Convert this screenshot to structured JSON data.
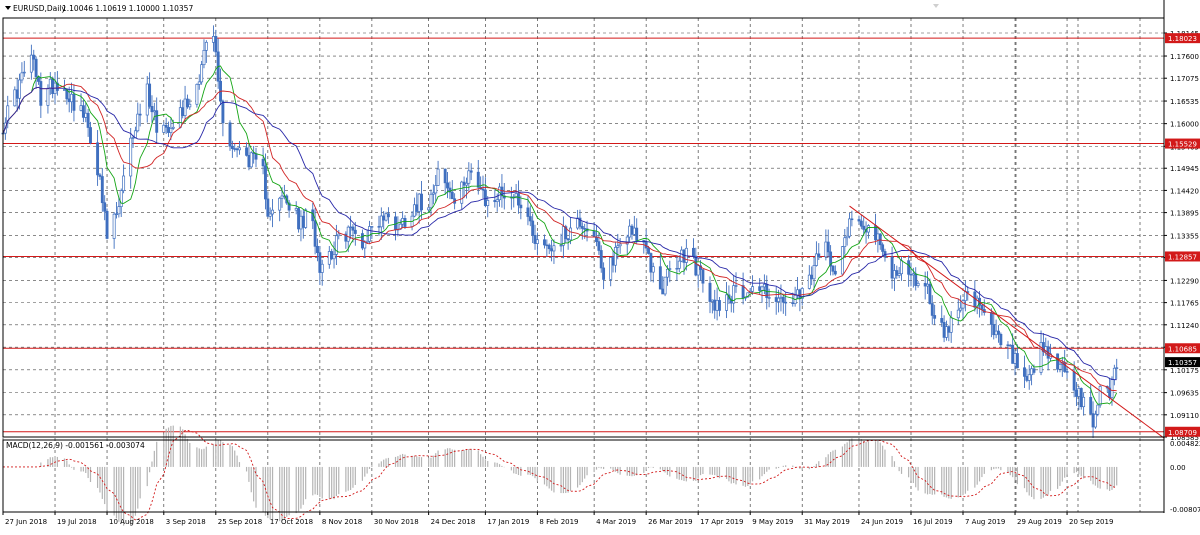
{
  "window": {
    "symbol_label": "EURUSD,Daily",
    "ohlc_label": "1.10046 1.10619 1.10000 1.10357",
    "indicator_label": "MACD(12,26,9) -0.001561 -0.003074"
  },
  "colors": {
    "background": "#ffffff",
    "candle": "#3f6fbf",
    "ma_fast": "#14a514",
    "ma_mid": "#d22626",
    "ma_slow": "#2828a8",
    "level_line": "#d21919",
    "trendline": "#d21919",
    "price_marker_bg": "#d21919",
    "current_marker_bg": "#000000",
    "grid": "#444444",
    "macd_hist": "#b4b4b4",
    "macd_signal": "#d21919"
  },
  "chart_data": [
    {
      "type": "candlestick",
      "title": "EURUSD,Daily",
      "ylim": [
        1.08585,
        1.185
      ],
      "xlim": [
        "2018-06-27",
        "2019-10-31"
      ],
      "x_tick_labels": [
        "27 Jun 2018",
        "19 Jul 2018",
        "10 Aug 2018",
        "3 Sep 2018",
        "25 Sep 2018",
        "17 Oct 2018",
        "8 Nov 2018",
        "30 Nov 2018",
        "24 Dec 2018",
        "17 Jan 2019",
        "8 Feb 2019",
        "4 Mar 2019",
        "26 Mar 2019",
        "17 Apr 2019",
        "9 May 2019",
        "31 May 2019",
        "24 Jun 2019",
        "16 Jul 2019",
        "7 Aug 2019",
        "29 Aug 2019",
        "20 Sep 2019"
      ],
      "x_tick_dates": [
        "2018-06-27",
        "2018-07-19",
        "2018-08-10",
        "2018-09-03",
        "2018-09-25",
        "2018-10-17",
        "2018-11-08",
        "2018-11-30",
        "2018-12-24",
        "2019-01-17",
        "2019-02-08",
        "2019-03-04",
        "2019-03-26",
        "2019-04-17",
        "2019-05-09",
        "2019-05-31",
        "2019-06-24",
        "2019-07-16",
        "2019-08-07",
        "2019-08-29",
        "2019-09-20"
      ],
      "y_tick_labels": [
        "1.18145",
        "1.17600",
        "1.17075",
        "1.16535",
        "1.16000",
        "1.15465",
        "1.14945",
        "1.14420",
        "1.13895",
        "1.13355",
        "1.12830",
        "1.12290",
        "1.11765",
        "1.11240",
        "1.10710",
        "1.10175",
        "1.09635",
        "1.09110",
        "1.08585"
      ],
      "grid": true,
      "price_levels": [
        1.18023,
        1.15529,
        1.12857,
        1.10685,
        1.08709
      ],
      "price_level_labels": [
        "1.18023",
        "1.15529",
        "1.12857",
        "1.10685",
        "1.08709"
      ],
      "current_price": 1.10357,
      "current_price_label": "1.10357",
      "trendline": {
        "start": [
          "2019-06-20",
          1.1405
        ],
        "end": [
          "2019-10-31",
          1.0856
        ]
      },
      "price_path": [
        [
          "2018-06-27",
          1.16
        ],
        [
          "2018-07-03",
          1.168
        ],
        [
          "2018-07-09",
          1.176
        ],
        [
          "2018-07-13",
          1.166
        ],
        [
          "2018-07-19",
          1.17
        ],
        [
          "2018-07-25",
          1.167
        ],
        [
          "2018-07-31",
          1.162
        ],
        [
          "2018-08-05",
          1.154
        ],
        [
          "2018-08-10",
          1.133
        ],
        [
          "2018-08-15",
          1.14
        ],
        [
          "2018-08-21",
          1.158
        ],
        [
          "2018-08-27",
          1.168
        ],
        [
          "2018-09-01",
          1.158
        ],
        [
          "2018-09-05",
          1.16
        ],
        [
          "2018-09-10",
          1.163
        ],
        [
          "2018-09-16",
          1.167
        ],
        [
          "2018-09-20",
          1.177
        ],
        [
          "2018-09-24",
          1.181
        ],
        [
          "2018-09-28",
          1.16
        ],
        [
          "2018-10-03",
          1.154
        ],
        [
          "2018-10-09",
          1.152
        ],
        [
          "2018-10-15",
          1.148
        ],
        [
          "2018-10-17",
          1.14
        ],
        [
          "2018-10-24",
          1.142
        ],
        [
          "2018-10-31",
          1.136
        ],
        [
          "2018-11-04",
          1.139
        ],
        [
          "2018-11-08",
          1.127
        ],
        [
          "2018-11-13",
          1.13
        ],
        [
          "2018-11-20",
          1.135
        ],
        [
          "2018-11-27",
          1.132
        ],
        [
          "2018-11-30",
          1.136
        ],
        [
          "2018-12-05",
          1.138
        ],
        [
          "2018-12-12",
          1.136
        ],
        [
          "2018-12-18",
          1.141
        ],
        [
          "2018-12-24",
          1.142
        ],
        [
          "2018-12-28",
          1.149
        ],
        [
          "2019-01-05",
          1.14
        ],
        [
          "2019-01-10",
          1.15
        ],
        [
          "2019-01-17",
          1.141
        ],
        [
          "2019-01-25",
          1.144
        ],
        [
          "2019-02-01",
          1.142
        ],
        [
          "2019-02-08",
          1.132
        ],
        [
          "2019-02-14",
          1.131
        ],
        [
          "2019-02-20",
          1.134
        ],
        [
          "2019-02-26",
          1.137
        ],
        [
          "2019-03-04",
          1.134
        ],
        [
          "2019-03-08",
          1.122
        ],
        [
          "2019-03-13",
          1.13
        ],
        [
          "2019-03-20",
          1.136
        ],
        [
          "2019-03-26",
          1.129
        ],
        [
          "2019-04-01",
          1.121
        ],
        [
          "2019-04-08",
          1.127
        ],
        [
          "2019-04-13",
          1.13
        ],
        [
          "2019-04-17",
          1.125
        ],
        [
          "2019-04-23",
          1.117
        ],
        [
          "2019-04-29",
          1.119
        ],
        [
          "2019-05-03",
          1.12
        ],
        [
          "2019-05-09",
          1.121
        ],
        [
          "2019-05-15",
          1.121
        ],
        [
          "2019-05-23",
          1.117
        ],
        [
          "2019-05-31",
          1.119
        ],
        [
          "2019-06-05",
          1.126
        ],
        [
          "2019-06-10",
          1.131
        ],
        [
          "2019-06-14",
          1.126
        ],
        [
          "2019-06-20",
          1.137
        ],
        [
          "2019-06-26",
          1.137
        ],
        [
          "2019-07-01",
          1.133
        ],
        [
          "2019-07-08",
          1.124
        ],
        [
          "2019-07-12",
          1.127
        ],
        [
          "2019-07-16",
          1.123
        ],
        [
          "2019-07-22",
          1.123
        ],
        [
          "2019-07-25",
          1.116
        ],
        [
          "2019-07-31",
          1.11
        ],
        [
          "2019-08-07",
          1.12
        ],
        [
          "2019-08-14",
          1.116
        ],
        [
          "2019-08-20",
          1.11
        ],
        [
          "2019-08-25",
          1.107
        ],
        [
          "2019-08-29",
          1.104
        ],
        [
          "2019-09-03",
          1.097
        ],
        [
          "2019-09-09",
          1.106
        ],
        [
          "2019-09-14",
          1.104
        ],
        [
          "2019-09-20",
          1.101
        ],
        [
          "2019-09-26",
          1.094
        ],
        [
          "2019-10-01",
          1.089
        ],
        [
          "2019-10-04",
          1.097
        ],
        [
          "2019-10-08",
          1.097
        ],
        [
          "2019-10-11",
          1.103
        ]
      ]
    },
    {
      "type": "macd",
      "title": "MACD(12,26,9) -0.001561 -0.003074",
      "y_tick_labels": [
        "0.004822",
        "0.00",
        "-0.00807"
      ],
      "ylim": [
        -0.00807,
        0.004822
      ],
      "macd_value": -0.001561,
      "signal_value": -0.003074
    }
  ]
}
